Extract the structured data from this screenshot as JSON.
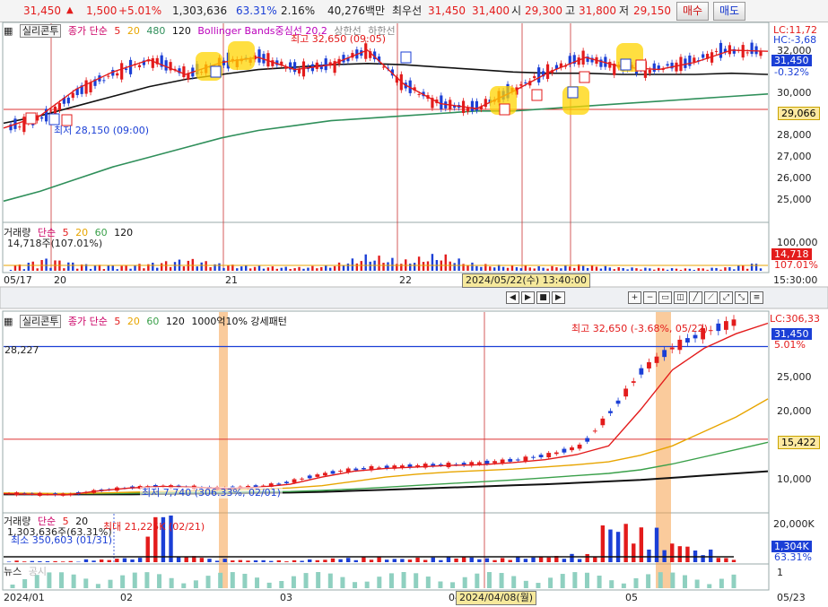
{
  "topbar": {
    "price": "31,450",
    "change": "1,500",
    "change_pct": "+5.01%",
    "volume": "1,303,636",
    "vol_ratio": "63.31%",
    "turnover": "2.16%",
    "amount": "40,276백만",
    "best_ask_label": "최우선",
    "best_ask": "31,450",
    "best_bid": "31,400",
    "open_label": "시",
    "open": "29,300",
    "high_label": "고",
    "high": "31,800",
    "low_label": "저",
    "low": "29,150",
    "buy_label": "매수",
    "sell_label": "매도"
  },
  "colors": {
    "up": "#e31b1b",
    "down": "#1b3fd6",
    "ma5": "#e31b1b",
    "ma20": "#e8a500",
    "ma60": "#3aa04a",
    "ma120": "#111111",
    "ma480": "#2f8f5a",
    "highlight": "#f5a14a",
    "marker": "#ffd400"
  },
  "top_chart": {
    "indicator_tab": "실리콘투",
    "legend": {
      "ma": "종가 단순",
      "p1": "5",
      "p2": "20",
      "p3": "480",
      "p4": "120",
      "bb": "Bollinger Bands중심선 20,2",
      "bb_up": "상한선",
      "bb_dn": "하한선"
    },
    "high_annot": "최고 32,650 (09:05)",
    "low_annot": "최저 28,150 (09:00)",
    "lc": "LC:11,72",
    "hc": "HC:-3,68",
    "y_ticks": [
      "32,000",
      "31,450",
      "-0.32%",
      "30,000",
      "29,066",
      "28,000",
      "27,000",
      "26,000",
      "25,000"
    ],
    "cur_price": "31,450",
    "ref_line": "29,066",
    "vol_legend": {
      "name": "거래량",
      "ma": "단순",
      "p1": "5",
      "p2": "20",
      "p3": "60",
      "p4": "120"
    },
    "vol_value": "14,718주(107.01%)",
    "vol_ticks": [
      "100,000",
      "14,718",
      "107.01%"
    ],
    "x_ticks": [
      "05/17",
      "20",
      "21",
      "22",
      "15:30:00"
    ],
    "cursor_time": "2024/05/22(수) 13:40:00"
  },
  "bottom_chart": {
    "indicator_tab": "실리콘투",
    "legend": {
      "ma": "종가 단순",
      "p1": "5",
      "p2": "20",
      "p3": "60",
      "p4": "120",
      "pattern": "1000억10% 강세패턴"
    },
    "high_annot": "최고 32,650 (-3.68%, 05/22)",
    "low_annot": "최저 7,740 (306.33%, 02/01)",
    "lc": "LC:306,33",
    "left_ref": "28,227",
    "y_ticks": [
      "31,450",
      "5.01%",
      "25,000",
      "20,000",
      "15,422",
      "10,000"
    ],
    "vol_legend": {
      "name": "거래량",
      "ma": "단순",
      "p1": "5",
      "p2": "20"
    },
    "vol_value": "1,303,636주(63.31%)",
    "vol_max": "최대 21,225K (02/21)",
    "vol_min": "최소 350,603 (01/31)",
    "vol_ticks": [
      "20,000K",
      "1,304K",
      "63.31%"
    ],
    "news_label": "뉴스",
    "news_sub": "공시",
    "news_tick": "1",
    "x_ticks": [
      "2024/01",
      "02",
      "03",
      "04",
      "05",
      "05/23"
    ],
    "cursor_date": "2024/04/08(월)"
  },
  "chart_data": [
    {
      "type": "candlestick",
      "title": "실리콘투",
      "interval": "intraday",
      "x": [
        "05/17",
        "20",
        "21",
        "22"
      ],
      "ylim": [
        24500,
        32600
      ],
      "series": [
        {
          "name": "종가 단순 5",
          "values": [
            28300,
            28800,
            29900,
            30600,
            31100,
            30500,
            31000,
            31200,
            30700,
            30900,
            31500,
            30100,
            29300,
            29100,
            29800,
            30600,
            31200,
            30800,
            30700,
            31000,
            31500,
            31450
          ]
        },
        {
          "name": "480",
          "values": [
            25300,
            25700,
            26200,
            26700,
            27100,
            27500,
            27900,
            28200,
            28400,
            28600,
            28700,
            28800,
            28900,
            29000,
            29000,
            29100,
            29200,
            29300,
            29400,
            29500,
            29600,
            29700
          ]
        },
        {
          "name": "120",
          "values": [
            28500,
            28800,
            29200,
            29600,
            30000,
            30300,
            30500,
            30700,
            30800,
            30900,
            30950,
            30900,
            30800,
            30700,
            30600,
            30550,
            30550,
            30500,
            30500,
            30500,
            30550,
            30500
          ]
        }
      ],
      "volume": [
        8000,
        22000,
        12000,
        9000,
        14000,
        21000,
        11000,
        8000,
        6000,
        10000,
        28000,
        18000,
        30000,
        12000,
        9000,
        7000,
        11000,
        6000,
        5000,
        4000,
        6000,
        14718
      ],
      "vlim": [
        0,
        120000
      ]
    },
    {
      "type": "candlestick",
      "title": "실리콘투",
      "interval": "daily",
      "x": [
        "2024/01",
        "02",
        "03",
        "04",
        "05",
        "05/23"
      ],
      "ylim": [
        5500,
        33000
      ],
      "series": [
        {
          "name": "종가",
          "values": [
            7900,
            7800,
            7740,
            8300,
            8700,
            8900,
            8800,
            8600,
            8800,
            9200,
            10200,
            11000,
            11400,
            11600,
            11800,
            11900,
            12200,
            12600,
            13300,
            14500,
            19500,
            25000,
            28000,
            30000,
            31450
          ]
        },
        {
          "name": "20",
          "values": [
            8000,
            7950,
            7900,
            8000,
            8100,
            8200,
            8300,
            8400,
            8500,
            8700,
            9000,
            9600,
            10200,
            10600,
            10900,
            11100,
            11300,
            11600,
            11900,
            12300,
            13200,
            14500,
            16500,
            18500,
            21000
          ]
        },
        {
          "name": "60",
          "values": [
            7900,
            7900,
            7900,
            7900,
            7950,
            8000,
            8050,
            8100,
            8150,
            8200,
            8350,
            8550,
            8800,
            9050,
            9300,
            9550,
            9800,
            10100,
            10400,
            10700,
            11200,
            12000,
            13000,
            14000,
            15000
          ]
        },
        {
          "name": "120",
          "values": [
            7800,
            7800,
            7800,
            7800,
            7800,
            7850,
            7900,
            7950,
            8000,
            8050,
            8150,
            8300,
            8450,
            8600,
            8750,
            8900,
            9050,
            9200,
            9400,
            9600,
            9800,
            10100,
            10400,
            10700,
            11000
          ]
        }
      ],
      "volume": [
        500,
        400,
        351,
        900,
        1400,
        21225,
        2200,
        1100,
        700,
        600,
        900,
        1400,
        1700,
        1200,
        1500,
        1800,
        1300,
        1700,
        2100,
        2600,
        13000,
        11000,
        6500,
        4000,
        1304
      ],
      "vlim": [
        0,
        22000
      ]
    }
  ]
}
